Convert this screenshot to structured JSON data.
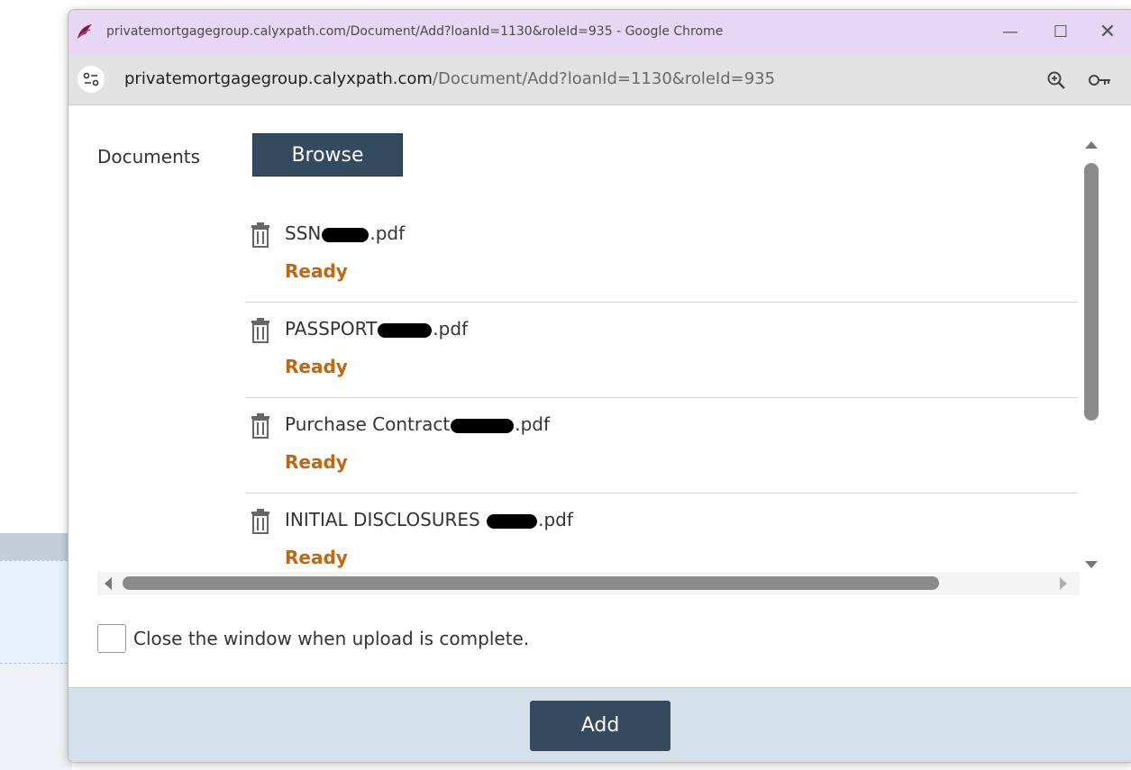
{
  "window": {
    "title": "privatemortgagegroup.calyxpath.com/Document/Add?loanId=1130&roleId=935 - Google Chrome",
    "minimize_glyph": "—",
    "maximize_glyph": "☐",
    "close_glyph": "✕"
  },
  "addressbar": {
    "url_host": "privatemortgagegroup.calyxpath.com",
    "url_path": "/Document/Add?loanId=1130&roleId=935",
    "icons": [
      "site-info-icon",
      "zoom-icon",
      "password-key-icon"
    ]
  },
  "form": {
    "documents_label": "Documents",
    "browse_label": "Browse",
    "files": [
      {
        "prefix": "SSN",
        "suffix": ".pdf",
        "status": "Ready"
      },
      {
        "prefix": "PASSPORT",
        "suffix": ".pdf",
        "status": "Ready"
      },
      {
        "prefix": "Purchase Contract",
        "suffix": ".pdf",
        "status": "Ready"
      },
      {
        "prefix": "INITIAL DISCLOSURES ",
        "suffix": ".pdf",
        "status": "Ready"
      }
    ],
    "close_when_complete_label": "Close the window when upload is complete.",
    "close_when_complete_checked": false
  },
  "footer": {
    "add_label": "Add"
  },
  "colors": {
    "titlebar": "#e8d6f5",
    "button": "#334a5f",
    "status_ready": "#c2660f",
    "footer": "#d5e1ea"
  }
}
